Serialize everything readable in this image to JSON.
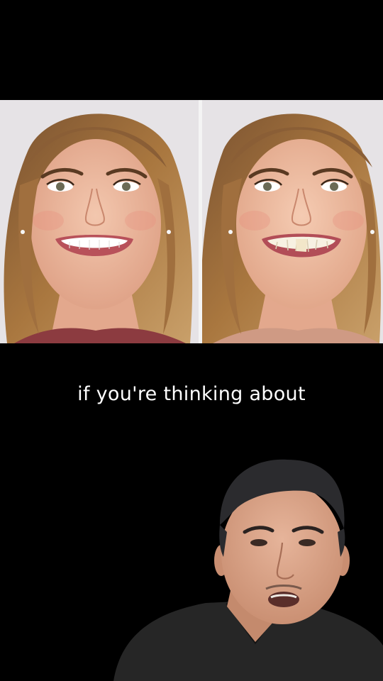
{
  "caption": "if you're thinking about",
  "panels": [
    {
      "side": "left",
      "smile": "white-teeth"
    },
    {
      "side": "right",
      "smile": "uneven-teeth"
    }
  ],
  "colors": {
    "background": "#000000",
    "studio_backdrop": "#e6e3e6",
    "hair": "#9a6a3c",
    "skin": "#eab79e",
    "scrubs": "#262626"
  }
}
